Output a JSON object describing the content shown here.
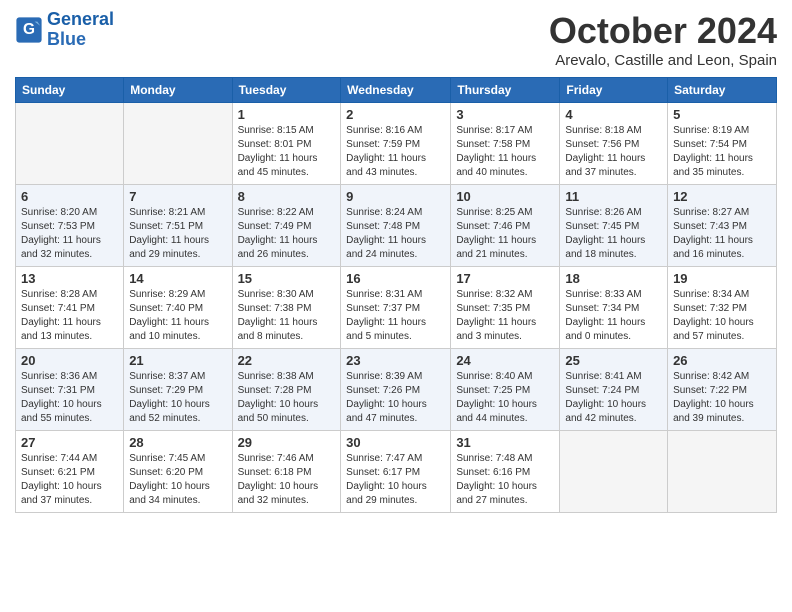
{
  "logo": {
    "line1": "General",
    "line2": "Blue"
  },
  "title": "October 2024",
  "location": "Arevalo, Castille and Leon, Spain",
  "days_of_week": [
    "Sunday",
    "Monday",
    "Tuesday",
    "Wednesday",
    "Thursday",
    "Friday",
    "Saturday"
  ],
  "weeks": [
    [
      {
        "day": "",
        "empty": true
      },
      {
        "day": "",
        "empty": true
      },
      {
        "day": "1",
        "sunrise": "8:15 AM",
        "sunset": "8:01 PM",
        "daylight": "11 hours and 45 minutes."
      },
      {
        "day": "2",
        "sunrise": "8:16 AM",
        "sunset": "7:59 PM",
        "daylight": "11 hours and 43 minutes."
      },
      {
        "day": "3",
        "sunrise": "8:17 AM",
        "sunset": "7:58 PM",
        "daylight": "11 hours and 40 minutes."
      },
      {
        "day": "4",
        "sunrise": "8:18 AM",
        "sunset": "7:56 PM",
        "daylight": "11 hours and 37 minutes."
      },
      {
        "day": "5",
        "sunrise": "8:19 AM",
        "sunset": "7:54 PM",
        "daylight": "11 hours and 35 minutes."
      }
    ],
    [
      {
        "day": "6",
        "sunrise": "8:20 AM",
        "sunset": "7:53 PM",
        "daylight": "11 hours and 32 minutes."
      },
      {
        "day": "7",
        "sunrise": "8:21 AM",
        "sunset": "7:51 PM",
        "daylight": "11 hours and 29 minutes."
      },
      {
        "day": "8",
        "sunrise": "8:22 AM",
        "sunset": "7:49 PM",
        "daylight": "11 hours and 26 minutes."
      },
      {
        "day": "9",
        "sunrise": "8:24 AM",
        "sunset": "7:48 PM",
        "daylight": "11 hours and 24 minutes."
      },
      {
        "day": "10",
        "sunrise": "8:25 AM",
        "sunset": "7:46 PM",
        "daylight": "11 hours and 21 minutes."
      },
      {
        "day": "11",
        "sunrise": "8:26 AM",
        "sunset": "7:45 PM",
        "daylight": "11 hours and 18 minutes."
      },
      {
        "day": "12",
        "sunrise": "8:27 AM",
        "sunset": "7:43 PM",
        "daylight": "11 hours and 16 minutes."
      }
    ],
    [
      {
        "day": "13",
        "sunrise": "8:28 AM",
        "sunset": "7:41 PM",
        "daylight": "11 hours and 13 minutes."
      },
      {
        "day": "14",
        "sunrise": "8:29 AM",
        "sunset": "7:40 PM",
        "daylight": "11 hours and 10 minutes."
      },
      {
        "day": "15",
        "sunrise": "8:30 AM",
        "sunset": "7:38 PM",
        "daylight": "11 hours and 8 minutes."
      },
      {
        "day": "16",
        "sunrise": "8:31 AM",
        "sunset": "7:37 PM",
        "daylight": "11 hours and 5 minutes."
      },
      {
        "day": "17",
        "sunrise": "8:32 AM",
        "sunset": "7:35 PM",
        "daylight": "11 hours and 3 minutes."
      },
      {
        "day": "18",
        "sunrise": "8:33 AM",
        "sunset": "7:34 PM",
        "daylight": "11 hours and 0 minutes."
      },
      {
        "day": "19",
        "sunrise": "8:34 AM",
        "sunset": "7:32 PM",
        "daylight": "10 hours and 57 minutes."
      }
    ],
    [
      {
        "day": "20",
        "sunrise": "8:36 AM",
        "sunset": "7:31 PM",
        "daylight": "10 hours and 55 minutes."
      },
      {
        "day": "21",
        "sunrise": "8:37 AM",
        "sunset": "7:29 PM",
        "daylight": "10 hours and 52 minutes."
      },
      {
        "day": "22",
        "sunrise": "8:38 AM",
        "sunset": "7:28 PM",
        "daylight": "10 hours and 50 minutes."
      },
      {
        "day": "23",
        "sunrise": "8:39 AM",
        "sunset": "7:26 PM",
        "daylight": "10 hours and 47 minutes."
      },
      {
        "day": "24",
        "sunrise": "8:40 AM",
        "sunset": "7:25 PM",
        "daylight": "10 hours and 44 minutes."
      },
      {
        "day": "25",
        "sunrise": "8:41 AM",
        "sunset": "7:24 PM",
        "daylight": "10 hours and 42 minutes."
      },
      {
        "day": "26",
        "sunrise": "8:42 AM",
        "sunset": "7:22 PM",
        "daylight": "10 hours and 39 minutes."
      }
    ],
    [
      {
        "day": "27",
        "sunrise": "7:44 AM",
        "sunset": "6:21 PM",
        "daylight": "10 hours and 37 minutes."
      },
      {
        "day": "28",
        "sunrise": "7:45 AM",
        "sunset": "6:20 PM",
        "daylight": "10 hours and 34 minutes."
      },
      {
        "day": "29",
        "sunrise": "7:46 AM",
        "sunset": "6:18 PM",
        "daylight": "10 hours and 32 minutes."
      },
      {
        "day": "30",
        "sunrise": "7:47 AM",
        "sunset": "6:17 PM",
        "daylight": "10 hours and 29 minutes."
      },
      {
        "day": "31",
        "sunrise": "7:48 AM",
        "sunset": "6:16 PM",
        "daylight": "10 hours and 27 minutes."
      },
      {
        "day": "",
        "empty": true
      },
      {
        "day": "",
        "empty": true
      }
    ]
  ]
}
